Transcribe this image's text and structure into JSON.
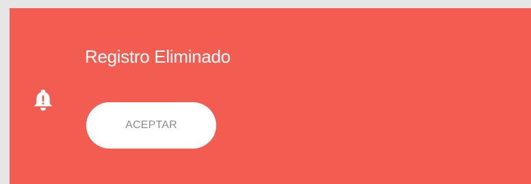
{
  "notification": {
    "icon": "bell-alert-icon",
    "message": "Registro Eliminado",
    "accept_label": "ACEPTAR",
    "colors": {
      "background": "#f25c51",
      "text": "#ffffff",
      "button_background": "#ffffff",
      "button_text": "#8a8a8a"
    }
  }
}
